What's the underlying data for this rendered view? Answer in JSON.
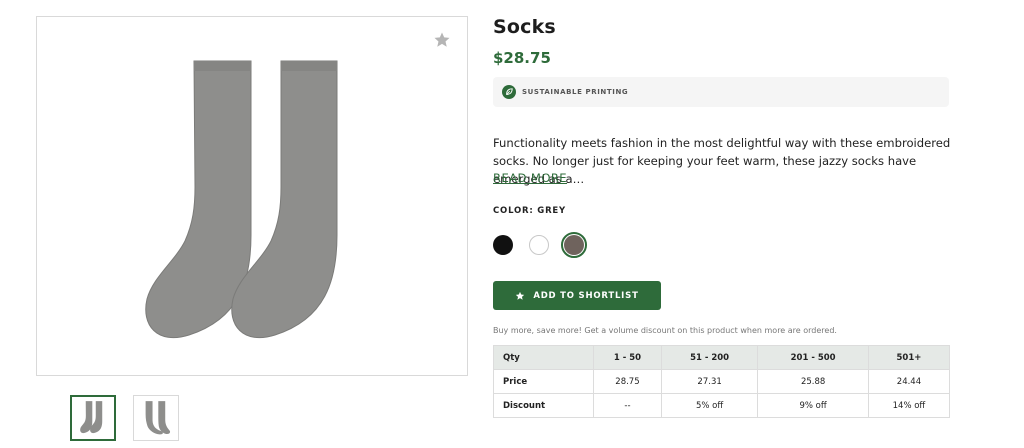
{
  "product": {
    "title": "Socks",
    "price": "$28.75",
    "badge": "SUSTAINABLE PRINTING",
    "description": "Functionality meets fashion in the most delightful way with these embroidered socks. No longer just for keeping your feet warm, these jazzy socks have emerged as a…",
    "read_more": "READ MORE",
    "color_label": "COLOR: GREY",
    "colors": [
      {
        "name": "black",
        "hex": "#111111"
      },
      {
        "name": "white",
        "hex": "#ffffff"
      },
      {
        "name": "grey",
        "hex": "#6f635d",
        "selected": true
      }
    ],
    "sock_color": "#8e8e8c",
    "accent": "#2e6b3a"
  },
  "actions": {
    "shortlist_label": "ADD TO SHORTLIST"
  },
  "volume": {
    "note": "Buy more, save more! Get a volume discount on this product when more are ordered.",
    "headers": [
      "Qty",
      "1 - 50",
      "51 - 200",
      "201 - 500",
      "501+"
    ],
    "rows": [
      [
        "Price",
        "28.75",
        "27.31",
        "25.88",
        "24.44"
      ],
      [
        "Discount",
        "--",
        "5% off",
        "9% off",
        "14% off"
      ]
    ]
  }
}
